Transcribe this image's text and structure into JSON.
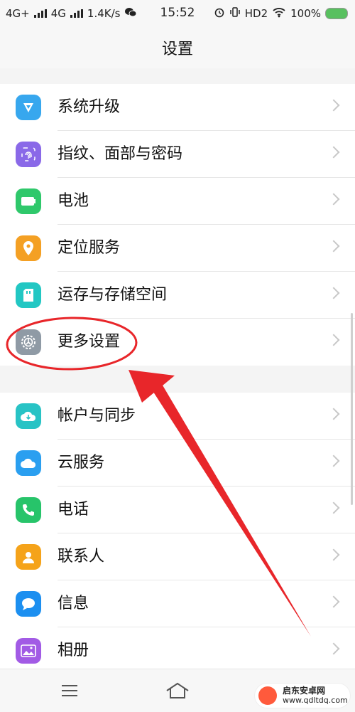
{
  "status": {
    "network1": "4G+",
    "network2": "4G",
    "speed": "1.4K/s",
    "time": "15:52",
    "hd": "HD2",
    "battery_percent": "100%"
  },
  "header": {
    "title": "设置"
  },
  "groups": [
    {
      "items": [
        {
          "label": "系统升级",
          "icon": "system-upgrade-icon",
          "color": "#37a7ee"
        },
        {
          "label": "指纹、面部与密码",
          "icon": "fingerprint-icon",
          "color": "#8a69e8"
        },
        {
          "label": "电池",
          "icon": "battery-icon",
          "color": "#2fc86b"
        },
        {
          "label": "定位服务",
          "icon": "location-icon",
          "color": "#f4a024"
        },
        {
          "label": "运存与存储空间",
          "icon": "storage-icon",
          "color": "#22c7c3"
        },
        {
          "label": "更多设置",
          "icon": "gear-icon",
          "color": "#8f9aa5"
        }
      ]
    },
    {
      "items": [
        {
          "label": "帐户与同步",
          "icon": "cloud-sync-icon",
          "color": "#28c3c5"
        },
        {
          "label": "云服务",
          "icon": "cloud-icon",
          "color": "#2a9ff0"
        },
        {
          "label": "电话",
          "icon": "phone-icon",
          "color": "#27c46a"
        },
        {
          "label": "联系人",
          "icon": "contact-icon",
          "color": "#f5a31a"
        },
        {
          "label": "信息",
          "icon": "message-icon",
          "color": "#1c8ff0"
        },
        {
          "label": "相册",
          "icon": "gallery-icon",
          "color": "#a25be5"
        }
      ]
    }
  ],
  "watermark": {
    "line1": "启东安卓网",
    "line2": "www.qdltdq.com"
  },
  "annotation_color": "#e8262a"
}
